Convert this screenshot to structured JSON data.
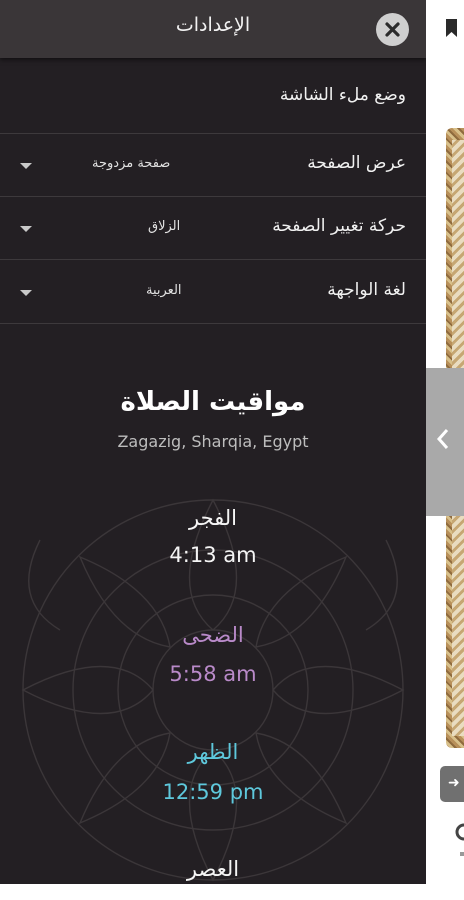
{
  "drawer": {
    "title": "الإعدادات",
    "close_icon": "close-x-icon"
  },
  "settings": {
    "fullscreen_label": "وضع ملء الشاشة",
    "page_view_label": "عرض الصفحة",
    "page_view_value": "صفحة مزدوجة",
    "page_transition_label": "حركة تغيير الصفحة",
    "page_transition_value": "الزلاق",
    "ui_language_label": "لغة الواجهة",
    "ui_language_value": "العربية"
  },
  "prayer": {
    "title": "مواقيت الصلاة",
    "location": "Zagazig, Sharqia, Egypt",
    "times": [
      {
        "name": "الفجر",
        "time": "4:13 am",
        "color": "#f5f5f5"
      },
      {
        "name": "الضحى",
        "time": "5:58 am",
        "color": "#b98ac9"
      },
      {
        "name": "الظهر",
        "time": "12:59 pm",
        "color": "#5ec8dc"
      },
      {
        "name": "العصر",
        "time": "",
        "color": "#f5f5f5"
      }
    ]
  },
  "colors": {
    "drawer_bg": "#231f23",
    "header_bg": "#3a3638",
    "duha_accent": "#b98ac9",
    "dhuhr_accent": "#5ec8dc"
  }
}
